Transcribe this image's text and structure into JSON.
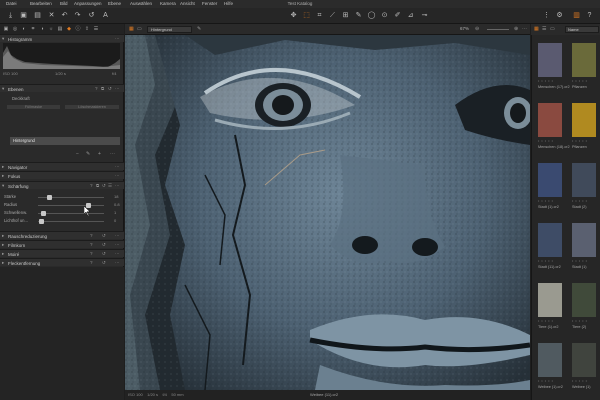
{
  "menubar": {
    "items": [
      "Datei",
      "Bearbeiten",
      "Bild",
      "Anpassungen",
      "Ebene",
      "Auswählen",
      "Kamera",
      "Ansicht",
      "Fenster",
      "Hilfe"
    ],
    "title": "Test Katalog"
  },
  "left_panel": {
    "histogram": {
      "title": "Histogramm",
      "labels": [
        "ISO 100",
        "1/20 s",
        "f/4"
      ]
    },
    "layers": {
      "title": "Ebenen",
      "mode": "Deckkraft",
      "buttons": [
        "Füllmaske",
        "Löschmaskieren"
      ],
      "selected_layer": "Hintergrund"
    },
    "sections": [
      "Navigator",
      "Fokus",
      "Schärfung"
    ],
    "sharpening": {
      "sliders": [
        {
          "label": "Stärke",
          "value": "18",
          "fraction": 0.14
        },
        {
          "label": "Radius",
          "value": "0.8",
          "fraction": 0.78
        },
        {
          "label": "Schwellenw.",
          "value": "1",
          "fraction": 0.05
        },
        {
          "label": "Lichthof un...",
          "value": "0",
          "fraction": 0.02
        }
      ]
    },
    "more_sections": [
      "Rauschreduzierung",
      "Filmkorn",
      "Moiré",
      "Fleckentfernung"
    ]
  },
  "viewer": {
    "layer_select": "Hintergrund",
    "zoom": "67%",
    "status_left": "ISO 100    1/20 s    f/4    50 mm",
    "status_center": "Weibee (11).cr2"
  },
  "browser": {
    "sort_label": "Name",
    "thumbnails": [
      {
        "label": "Menschen (17).cr2",
        "color": "#5a5a70"
      },
      {
        "label": "Pflanzen",
        "color": "#6a6a3a"
      },
      {
        "label": "Menschen (18).cr2",
        "color": "#8a4a40"
      },
      {
        "label": "Pflanzen",
        "color": "#b08a20"
      },
      {
        "label": "Stadt (1).cr2",
        "color": "#3a4a70"
      },
      {
        "label": "Stadt (2)",
        "color": "#404a5a"
      },
      {
        "label": "Stadt (11).cr2",
        "color": "#3e4c66"
      },
      {
        "label": "Stadt (1)",
        "color": "#5a6070"
      },
      {
        "label": "Tiere (1).cr2",
        "color": "#9a9a90"
      },
      {
        "label": "Tiere (2)",
        "color": "#404a3a"
      },
      {
        "label": "Weibee (1).cr2",
        "color": "#505a60"
      },
      {
        "label": "Weibee (1)",
        "color": "#40443e"
      }
    ]
  }
}
